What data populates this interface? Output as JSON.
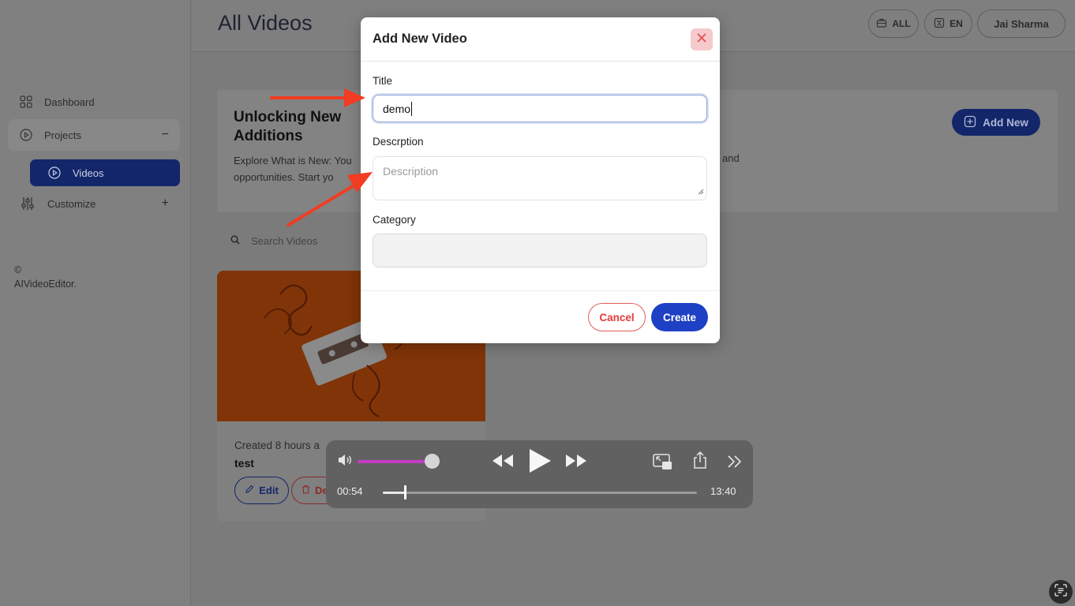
{
  "page": {
    "title": "All Videos"
  },
  "sidebar": {
    "items": [
      {
        "label": "Dashboard",
        "icon": "grid-icon"
      },
      {
        "label": "Projects",
        "icon": "play-circle-icon",
        "toggle": "−"
      },
      {
        "label": "Videos",
        "icon": "play-circle-icon"
      },
      {
        "label": "Customize",
        "icon": "sliders-icon",
        "toggle": "+"
      }
    ],
    "copyright_symbol": "©",
    "copyright_text": "AIVideoEditor."
  },
  "header": {
    "all_label": "ALL",
    "lang_label": "EN",
    "user_name": "Jai Sharma"
  },
  "banner": {
    "title": "Unlocking New Additions",
    "text": "Explore What is New: You opportunities. Start yo",
    "text_end": "and",
    "add_new_label": "Add New"
  },
  "search": {
    "placeholder": "Search Videos"
  },
  "card": {
    "created": "Created 8 hours a",
    "title": "test",
    "edit_label": "Edit",
    "delete_label": "De"
  },
  "modal": {
    "title": "Add New Video",
    "title_label": "Title",
    "title_value": "demo",
    "description_label": "Descrption",
    "description_placeholder": "Description",
    "category_label": "Category",
    "category_value": "",
    "cancel_label": "Cancel",
    "create_label": "Create"
  },
  "player": {
    "current_time": "00:54",
    "total_time": "13:40",
    "volume_level": 0.85,
    "progress_fraction": 0.07
  },
  "colors": {
    "accent": "#1e40c4",
    "cancel": "#e23b3b",
    "arrow": "#f23c23",
    "volume": "#c43bc4"
  }
}
